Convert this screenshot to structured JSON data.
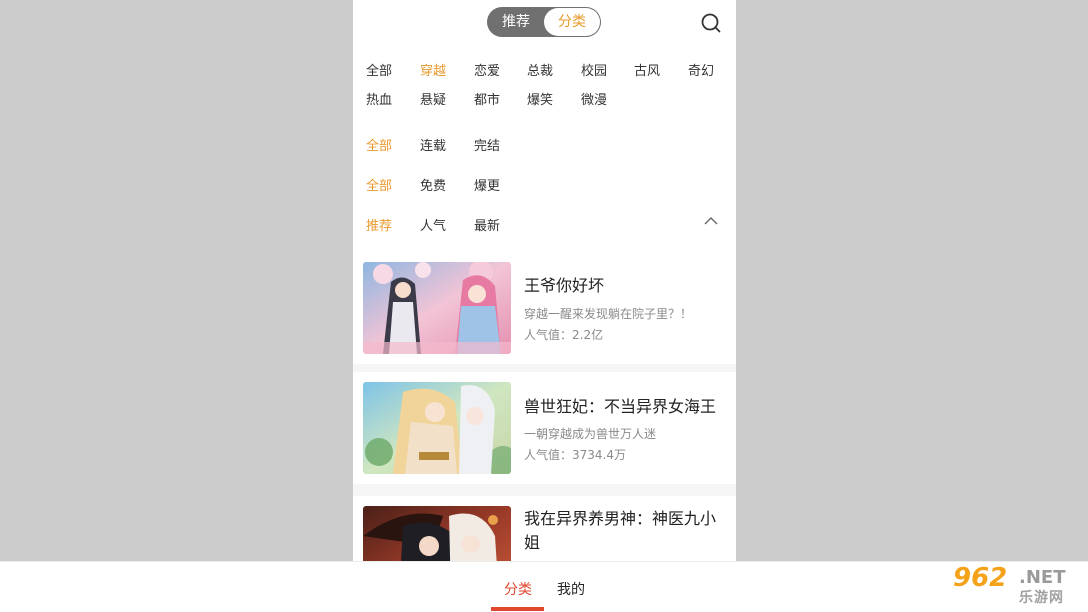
{
  "header": {
    "segments": [
      "推荐",
      "分类"
    ],
    "active_segment": "分类",
    "search_icon": "search-icon"
  },
  "filters": {
    "genres": [
      "全部",
      "穿越",
      "恋爱",
      "总裁",
      "校园",
      "古风",
      "奇幻",
      "热血",
      "悬疑",
      "都市",
      "爆笑",
      "微漫"
    ],
    "genre_active": "穿越",
    "status": [
      "全部",
      "连载",
      "完结"
    ],
    "status_active": "全部",
    "price": [
      "全部",
      "免费",
      "爆更"
    ],
    "price_active": "全部",
    "sort": [
      "推荐",
      "人气",
      "最新"
    ],
    "sort_active": "推荐",
    "collapse_icon": "chevron-up-icon"
  },
  "comics": [
    {
      "title": "王爷你好坏",
      "desc": "穿越一醒来发现躺在院子里？！",
      "popularity": "人气值：2.2亿"
    },
    {
      "title": "兽世狂妃：不当异界女海王",
      "desc": "一朝穿越成为兽世万人迷",
      "popularity": "人气值：3734.4万"
    },
    {
      "title": "我在异界养男神：神医九小姐",
      "desc": "",
      "popularity": ""
    }
  ],
  "bottom_nav": {
    "tabs": [
      "分类",
      "我的"
    ],
    "active": "分类"
  },
  "watermark": {
    "number": "962",
    "net": ".NET",
    "sub": "乐游网"
  },
  "colors": {
    "accent": "#e89a2c",
    "tab_active": "#e0482f",
    "segment_bg": "#707070"
  }
}
